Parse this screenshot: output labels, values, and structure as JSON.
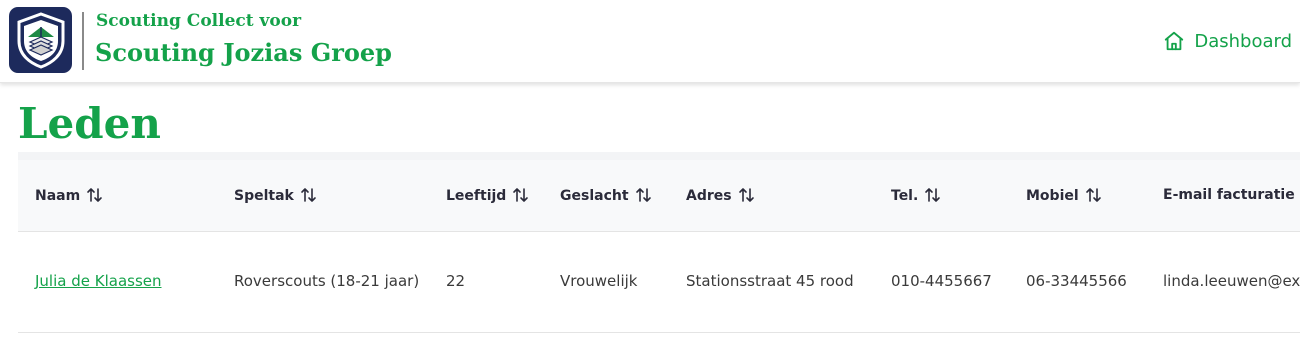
{
  "header": {
    "brand_sub": "Scouting Collect voor",
    "brand_main": "Scouting Jozias Groep",
    "dashboard_label": "Dashboard"
  },
  "page": {
    "title": "Leden"
  },
  "table": {
    "columns": [
      "Naam",
      "Speltak",
      "Leeftijd",
      "Geslacht",
      "Adres",
      "Tel.",
      "Mobiel",
      "E-mail facturatie"
    ],
    "rows": [
      {
        "naam": "Julia de Klaassen",
        "speltak": "Roverscouts (18-21 jaar)",
        "leeftijd": "22",
        "geslacht": "Vrouwelijk",
        "adres": "Stationsstraat 45 rood",
        "tel": "010-4455667",
        "mobiel": "06-33445566",
        "email": "linda.leeuwen@ex"
      }
    ]
  },
  "colors": {
    "accent": "#14a24a",
    "logo_bg": "#1d2a5c"
  },
  "icons": {
    "logo": "shield-tent-icon",
    "dashboard": "home-icon",
    "sort": "sort-arrows-icon"
  }
}
